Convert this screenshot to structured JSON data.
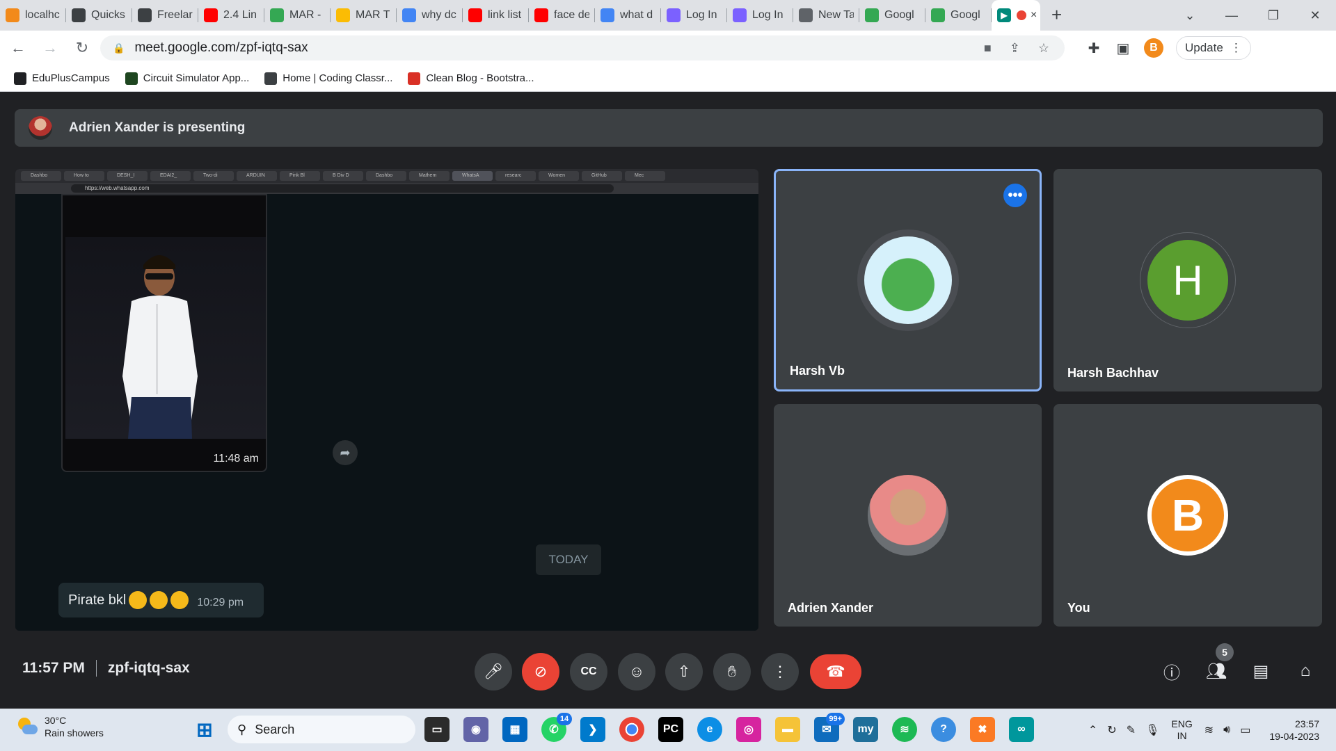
{
  "browser": {
    "tabs": [
      {
        "label": "localhc",
        "color": "#f28a1b"
      },
      {
        "label": "Quicks",
        "color": "#3c4043"
      },
      {
        "label": "Freelar",
        "color": "#3c4043"
      },
      {
        "label": "2.4 Lin",
        "color": "#ff0000"
      },
      {
        "label": "MAR -",
        "color": "#34a853"
      },
      {
        "label": "MAR T",
        "color": "#fbbc04"
      },
      {
        "label": "why dc",
        "color": "#4285f4"
      },
      {
        "label": "link list",
        "color": "#ff0000"
      },
      {
        "label": "face de",
        "color": "#ff0000"
      },
      {
        "label": "what d",
        "color": "#4285f4"
      },
      {
        "label": "Log In",
        "color": "#7b61ff"
      },
      {
        "label": "Log In",
        "color": "#7b61ff"
      },
      {
        "label": "New Ta",
        "color": "#5f6368"
      },
      {
        "label": "Googl",
        "color": "#34a853"
      },
      {
        "label": "Googl",
        "color": "#34a853"
      }
    ],
    "active_tab_close": "×",
    "new_tab": "+",
    "url": "meet.google.com/zpf-iqtq-sax",
    "update_label": "Update",
    "profile_initial": "B",
    "bookmarks": [
      {
        "label": "EduPlusCampus",
        "color": "#202124"
      },
      {
        "label": "Circuit Simulator App...",
        "color": "#1e4620"
      },
      {
        "label": "Home | Coding Classr...",
        "color": "#3c4043"
      },
      {
        "label": "Clean Blog - Bootstra...",
        "color": "#d93025"
      }
    ]
  },
  "meet": {
    "presenting_text": "Adrien Xander is presenting",
    "shared_screen": {
      "mini_tabs": [
        "Dashbo",
        "How to",
        "DESH_I",
        "EDAI2_",
        "Two-di",
        "ARDUIN",
        "Pink Bl",
        "B Div D",
        "Dashbo",
        "Mathem",
        "WhatsA",
        "researc",
        "Women",
        "GitHub",
        "Mec"
      ],
      "mini_url": "https://web.whatsapp.com",
      "photo_time": "11:48 am",
      "today_label": "TODAY",
      "message_text": "Pirate bkl",
      "message_time": "10:29 pm"
    },
    "participants": [
      {
        "name": "Harsh Vb",
        "speaking": true
      },
      {
        "name": "Harsh Bachhav",
        "initial": "H",
        "avatar_color": "#5a9e2f"
      },
      {
        "name": "Adrien Xander"
      },
      {
        "name": "You",
        "initial": "B",
        "avatar_color": "#f28a1b"
      }
    ],
    "more_options": "•••",
    "bottom": {
      "time": "11:57 PM",
      "meeting_code": "zpf-iqtq-sax",
      "participants_count": "5"
    }
  },
  "taskbar": {
    "weather_temp": "30°C",
    "weather_desc": "Rain showers",
    "search_label": "Search",
    "whatsapp_badge": "14",
    "mail_badge": "99+",
    "lang_top": "ENG",
    "lang_bottom": "IN",
    "time": "23:57",
    "date": "19-04-2023"
  }
}
